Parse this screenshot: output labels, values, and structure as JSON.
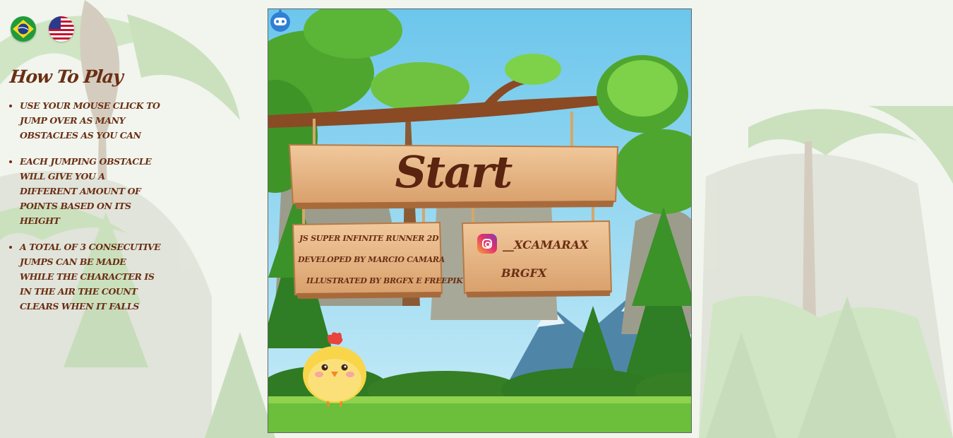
{
  "languages": [
    {
      "name": "Portuguese",
      "icon": "brazil-flag-icon"
    },
    {
      "name": "English",
      "icon": "usa-flag-icon"
    }
  ],
  "howto": {
    "title": "How To Play",
    "items": [
      "Use your mouse click to jump over as many obstacles as you can",
      "Each jumping obstacle will give you a different amount of points based on its height",
      "A total of 3 consecutive jumps can be made while the character is in the air The count clears when it falls"
    ]
  },
  "game": {
    "start_label": "Start",
    "credits": {
      "title": "JS Super Infinite Runner 2D",
      "developer": "Developed by Marcio Camara",
      "illustrator": "Illustrated by brgfx e freepik"
    },
    "social": {
      "instagram": "__xcamarax",
      "brgfx": "BRGFX",
      "instagram_icon": "instagram-icon",
      "brgfx_icon": "robot-icon"
    },
    "character": "chick-character"
  },
  "colors": {
    "text_brown": "#6b2e14",
    "wood": "#e8b98a",
    "sky": "#7fd0ef",
    "grass": "#6bbf3a"
  }
}
